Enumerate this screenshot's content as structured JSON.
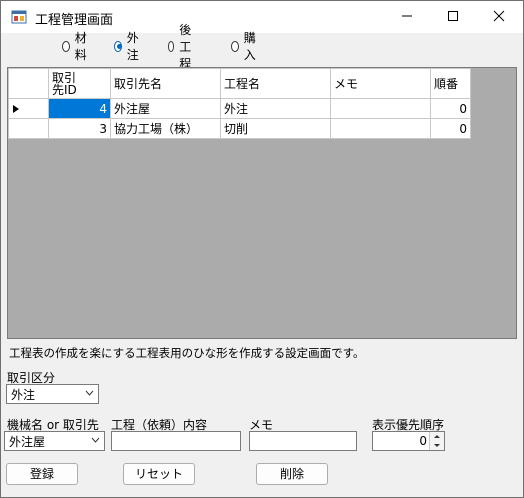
{
  "window": {
    "title": "工程管理画面"
  },
  "radios": [
    {
      "label": "材料",
      "checked": false
    },
    {
      "label": "外注",
      "checked": true
    },
    {
      "label": "後工程",
      "checked": false
    },
    {
      "label": "購入",
      "checked": false
    }
  ],
  "grid": {
    "headers": [
      "取引\n先ID",
      "取引先名",
      "工程名",
      "メモ",
      "順番"
    ],
    "rows": [
      {
        "id": "4",
        "name": "外注屋",
        "process": "外注",
        "memo": "",
        "order": "0"
      },
      {
        "id": "3",
        "name": "協力工場（株）",
        "process": "切削",
        "memo": "",
        "order": "0"
      }
    ]
  },
  "description": "工程表の作成を楽にする工程表用のひな形を作成する設定画面です。",
  "form": {
    "torihiki_kubun_label": "取引区分",
    "torihiki_kubun_value": "外注",
    "machine_label": "機械名 or 取引先",
    "machine_value": "外注屋",
    "process_label": "工程（依頼）内容",
    "memo_label": "メモ",
    "priority_label": "表示優先順序",
    "priority_value": "0"
  },
  "buttons": {
    "register": "登録",
    "reset": "リセット",
    "delete": "削除"
  }
}
